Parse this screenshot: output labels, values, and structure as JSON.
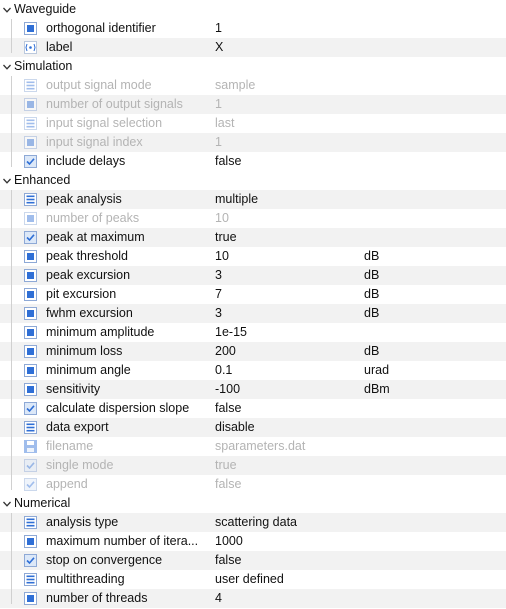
{
  "groups": [
    {
      "name": "Waveguide",
      "rows": [
        {
          "icon": "number-icon",
          "name": "orthogonal identifier",
          "value": "1",
          "unit": "",
          "enabled": true
        },
        {
          "icon": "label-icon",
          "name": "label",
          "value": "X",
          "unit": "",
          "enabled": true
        }
      ]
    },
    {
      "name": "Simulation",
      "rows": [
        {
          "icon": "choice-icon",
          "name": "output signal mode",
          "value": "sample",
          "unit": "",
          "enabled": false
        },
        {
          "icon": "number-icon",
          "name": "number of output signals",
          "value": "1",
          "unit": "",
          "enabled": false
        },
        {
          "icon": "choice-icon",
          "name": "input signal selection",
          "value": "last",
          "unit": "",
          "enabled": false
        },
        {
          "icon": "number-icon",
          "name": "input signal index",
          "value": "1",
          "unit": "",
          "enabled": false
        },
        {
          "icon": "checkbox-icon",
          "name": "include delays",
          "value": "false",
          "unit": "",
          "enabled": true
        }
      ]
    },
    {
      "name": "Enhanced",
      "rows": [
        {
          "icon": "choice-icon",
          "name": "peak analysis",
          "value": "multiple",
          "unit": "",
          "enabled": true
        },
        {
          "icon": "number-icon",
          "name": "number of peaks",
          "value": "10",
          "unit": "",
          "enabled": false
        },
        {
          "icon": "checkbox-icon",
          "name": "peak at maximum",
          "value": "true",
          "unit": "",
          "enabled": true
        },
        {
          "icon": "number-icon",
          "name": "peak threshold",
          "value": "10",
          "unit": "dB",
          "enabled": true
        },
        {
          "icon": "number-icon",
          "name": "peak excursion",
          "value": "3",
          "unit": "dB",
          "enabled": true
        },
        {
          "icon": "number-icon",
          "name": "pit excursion",
          "value": "7",
          "unit": "dB",
          "enabled": true
        },
        {
          "icon": "number-icon",
          "name": "fwhm excursion",
          "value": "3",
          "unit": "dB",
          "enabled": true
        },
        {
          "icon": "number-icon",
          "name": "minimum amplitude",
          "value": "1e-15",
          "unit": "",
          "enabled": true
        },
        {
          "icon": "number-icon",
          "name": "minimum loss",
          "value": "200",
          "unit": "dB",
          "enabled": true
        },
        {
          "icon": "number-icon",
          "name": "minimum angle",
          "value": "0.1",
          "unit": "urad",
          "enabled": true
        },
        {
          "icon": "number-icon",
          "name": "sensitivity",
          "value": "-100",
          "unit": "dBm",
          "enabled": true
        },
        {
          "icon": "checkbox-icon",
          "name": "calculate dispersion slope",
          "value": "false",
          "unit": "",
          "enabled": true
        },
        {
          "icon": "choice-icon",
          "name": "data export",
          "value": "disable",
          "unit": "",
          "enabled": true
        },
        {
          "icon": "save-icon",
          "name": "filename",
          "value": "sparameters.dat",
          "unit": "",
          "enabled": false
        },
        {
          "icon": "checkbox-icon",
          "name": "single mode",
          "value": "true",
          "unit": "",
          "enabled": false
        },
        {
          "icon": "checkbox-icon",
          "name": "append",
          "value": "false",
          "unit": "",
          "enabled": false
        }
      ]
    },
    {
      "name": "Numerical",
      "rows": [
        {
          "icon": "choice-icon",
          "name": "analysis type",
          "value": "scattering data",
          "unit": "",
          "enabled": true
        },
        {
          "icon": "number-icon",
          "name": "maximum number of itera...",
          "value": "1000",
          "unit": "",
          "enabled": true
        },
        {
          "icon": "checkbox-icon",
          "name": "stop on convergence",
          "value": "false",
          "unit": "",
          "enabled": true
        },
        {
          "icon": "choice-icon",
          "name": "multithreading",
          "value": "user defined",
          "unit": "",
          "enabled": true
        },
        {
          "icon": "number-icon",
          "name": "number of threads",
          "value": "4",
          "unit": "",
          "enabled": true
        }
      ]
    }
  ],
  "colors": {
    "icon_blue": "#2f6fd6",
    "icon_frame": "#8ea9d6",
    "row_alt": "#f2f2f2",
    "disabled_text": "#b4b4b4"
  }
}
